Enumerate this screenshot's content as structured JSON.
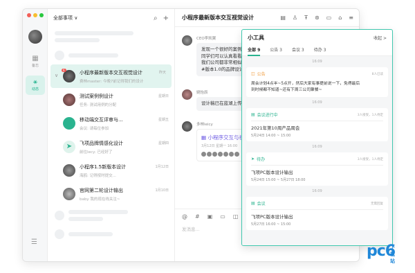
{
  "rail": {
    "items": [
      {
        "label": "备忘",
        "icon": "calendar-icon"
      },
      {
        "label": "动态",
        "icon": "activity-icon"
      }
    ]
  },
  "list": {
    "filter_label": "全部事项 ∨",
    "conversations": [
      {
        "title": "小程序最新版本交互视觉设计",
        "sub": "费林master: 今晚7前记得我们的设计",
        "time": "昨天",
        "badge": "6"
      },
      {
        "title": "测试案例例设计",
        "sub": "任务: 测试用例的分配",
        "time": "星期日",
        "badge": ""
      },
      {
        "title": "移动端交互评审与...",
        "sub": "会议: 请每位参加",
        "time": "星期五",
        "badge": ""
      },
      {
        "title": "飞项品牌情感化设计",
        "sub": "前往Iecy: 已经好了",
        "time": "星期四",
        "badge": ""
      },
      {
        "title": "小程序1.5新版本设计",
        "sub": "海鸥: 记得按时提交...",
        "time": "1月12日",
        "badge": ""
      },
      {
        "title": "官网第二轮设计输出",
        "sub": "baby 我的现在线关注~",
        "time": "1月10日",
        "badge": ""
      }
    ]
  },
  "chat": {
    "title": "小程序最新版本交互视觉设计",
    "msg1_name": "CEO李凯翼",
    "msg1_lines": [
      "发现一个很好的案例，",
      "同学们可以认真看看，这个",
      "我们公司都非常相似，可以",
      "#版本1.0的品牌设计方案。"
    ],
    "msg2_name": "姚怡辰",
    "msg2_text": "设计稿已在蓝湖上传，大家",
    "msg3_name": "多林leicy",
    "card_title": "小程序交互与视觉评审",
    "card_date": "3月12日 星期一 16:00",
    "input_placeholder": "发消息..."
  },
  "panel": {
    "title": "小工具",
    "close_label": "收起 >",
    "tabs": [
      "全部 9",
      "公告 3",
      "会议 3",
      "待办 3"
    ],
    "stamp1": "16:09",
    "notice": {
      "label": "公告",
      "meta": "8人已读",
      "text": [
        "周会计划4点半~5点开，然后大家有事提前说一下，免得最后",
        "到时候都不知道~还有下周三公司聚餐~"
      ]
    },
    "stamp2": "16:09",
    "meeting": {
      "label": "会议进行中",
      "meta": "3人接受，1人待定",
      "title": "2021年第10周产品周会",
      "time": "5月24日 14:00 ~ 15:00"
    },
    "stamp3": "16:09",
    "todo": {
      "label": "待办",
      "meta": "3人接受，1人待定",
      "title": "飞项PC版本设计输出",
      "time": "5月24日 15:00 ~ 5月27日 18:00"
    },
    "stamp4": "16:09",
    "meeting2": {
      "label": "会议",
      "meta": "无需回复",
      "title": "飞项PC版本设计输出",
      "time": "5月27日 16:00 ~ 15:00"
    }
  },
  "watermark": {
    "text": "pc6",
    "sub": "下载站"
  }
}
